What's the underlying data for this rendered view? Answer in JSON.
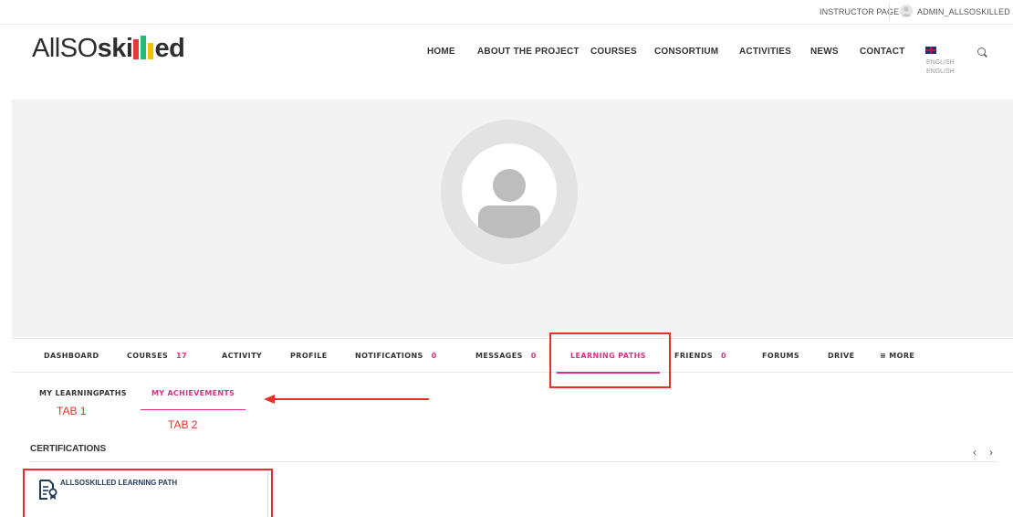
{
  "topbar": {
    "instructor_link": "INSTRUCTOR PAGE",
    "user_link": "ADMIN_ALLSOSKILLED"
  },
  "header": {
    "logo_prefix": "AllSO",
    "logo_suffix_1": "ski",
    "logo_suffix_2": "ed",
    "nav": [
      "HOME",
      "ABOUT THE PROJECT",
      "COURSES",
      "CONSORTIUM",
      "ACTIVITIES",
      "NEWS",
      "CONTACT"
    ],
    "language_line1": "ENGLISH",
    "language_line2": "ENGLISH"
  },
  "profile_tabs": [
    {
      "label": "DASHBOARD",
      "count": ""
    },
    {
      "label": "COURSES",
      "count": "17"
    },
    {
      "label": "ACTIVITY",
      "count": ""
    },
    {
      "label": "PROFILE",
      "count": ""
    },
    {
      "label": "NOTIFICATIONS",
      "count": "0"
    },
    {
      "label": "MESSAGES",
      "count": "0"
    },
    {
      "label": "LEARNING PATHS",
      "count": ""
    },
    {
      "label": "FRIENDS",
      "count": "0"
    },
    {
      "label": "FORUMS",
      "count": ""
    },
    {
      "label": "DRIVE",
      "count": ""
    },
    {
      "label": "≡ MORE",
      "count": ""
    }
  ],
  "sub_tabs": {
    "tab1": "MY LEARNINGPATHS",
    "tab2": "MY ACHIEVEMENTS"
  },
  "annotations": {
    "tab1": "TAB 1",
    "tab2": "TAB 2"
  },
  "certifications": {
    "title": "CERTIFICATIONS",
    "prev": "‹",
    "next": "›",
    "items": [
      "ALLSOSKILLED LEARNING PATH"
    ]
  },
  "colors": {
    "accent": "#d63384",
    "annotation": "#e8302b",
    "link": "#1f3b5a",
    "logo_bars": [
      "#e53935",
      "#2bb673",
      "#f2c200"
    ]
  },
  "icons": {
    "search": "search-icon",
    "flag": "uk-flag-icon",
    "certificate": "certificate-icon",
    "avatar": "default-avatar"
  }
}
